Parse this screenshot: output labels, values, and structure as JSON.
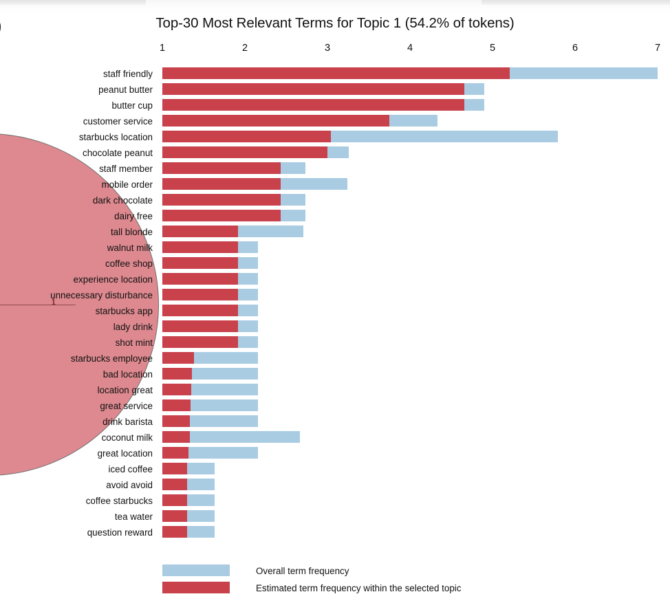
{
  "window": {
    "chrome_present": true
  },
  "left_cutoff_glyph": ")",
  "chart_data": {
    "type": "bar",
    "orientation": "horizontal",
    "stacked_overlay": true,
    "title": "Top-30 Most Relevant Terms for Topic 1 (54.2% of tokens)",
    "xlabel": "",
    "ylabel": "",
    "xlim": [
      0,
      7.05
    ],
    "x_ticks": [
      1,
      2,
      3,
      4,
      5,
      6,
      7
    ],
    "x_tick_labels": [
      "1",
      "2",
      "3",
      "4",
      "5",
      "6",
      "7"
    ],
    "grid": false,
    "legend_position": "bottom",
    "colors": {
      "overall": "#a9cce3",
      "estimated": "#c8414b"
    },
    "categories": [
      "staff friendly",
      "peanut butter",
      "butter cup",
      "customer service",
      "starbucks location",
      "chocolate peanut",
      "staff member",
      "mobile order",
      "dark chocolate",
      "dairy free",
      "tall blonde",
      "walnut milk",
      "coffee shop",
      "experience location",
      "unnecessary disturbance",
      "starbucks app",
      "lady drink",
      "shot mint",
      "starbucks employee",
      "bad location",
      "location great",
      "great service",
      "drink barista",
      "coconut milk",
      "great location",
      "iced coffee",
      "avoid avoid",
      "coffee starbucks",
      "tea water",
      "question reward"
    ],
    "series": [
      {
        "name": "Overall term frequency",
        "color": "#a9cce3",
        "values": [
          7.0,
          4.9,
          4.9,
          4.33,
          5.79,
          3.26,
          2.73,
          3.24,
          2.73,
          2.73,
          2.71,
          2.16,
          2.16,
          2.16,
          2.16,
          2.16,
          2.16,
          2.16,
          2.16,
          2.16,
          2.16,
          2.16,
          2.16,
          2.67,
          2.16,
          1.63,
          1.63,
          1.63,
          1.63,
          1.63
        ]
      },
      {
        "name": "Estimated term frequency within the selected topic",
        "color": "#c8414b",
        "values": [
          5.21,
          4.66,
          4.66,
          3.75,
          3.04,
          3.0,
          2.43,
          2.43,
          2.43,
          2.43,
          1.92,
          1.92,
          1.92,
          1.92,
          1.92,
          1.92,
          1.92,
          1.92,
          1.38,
          1.36,
          1.35,
          1.34,
          1.33,
          1.33,
          1.32,
          1.3,
          1.3,
          1.3,
          1.3,
          1.3
        ]
      }
    ]
  },
  "legend": {
    "items": [
      {
        "label": "Overall term frequency",
        "color": "#a9cce3"
      },
      {
        "label": "Estimated term frequency within the selected topic",
        "color": "#c8414b"
      }
    ]
  },
  "topic_bubble": {
    "label": "1",
    "color": "#c8414b"
  }
}
